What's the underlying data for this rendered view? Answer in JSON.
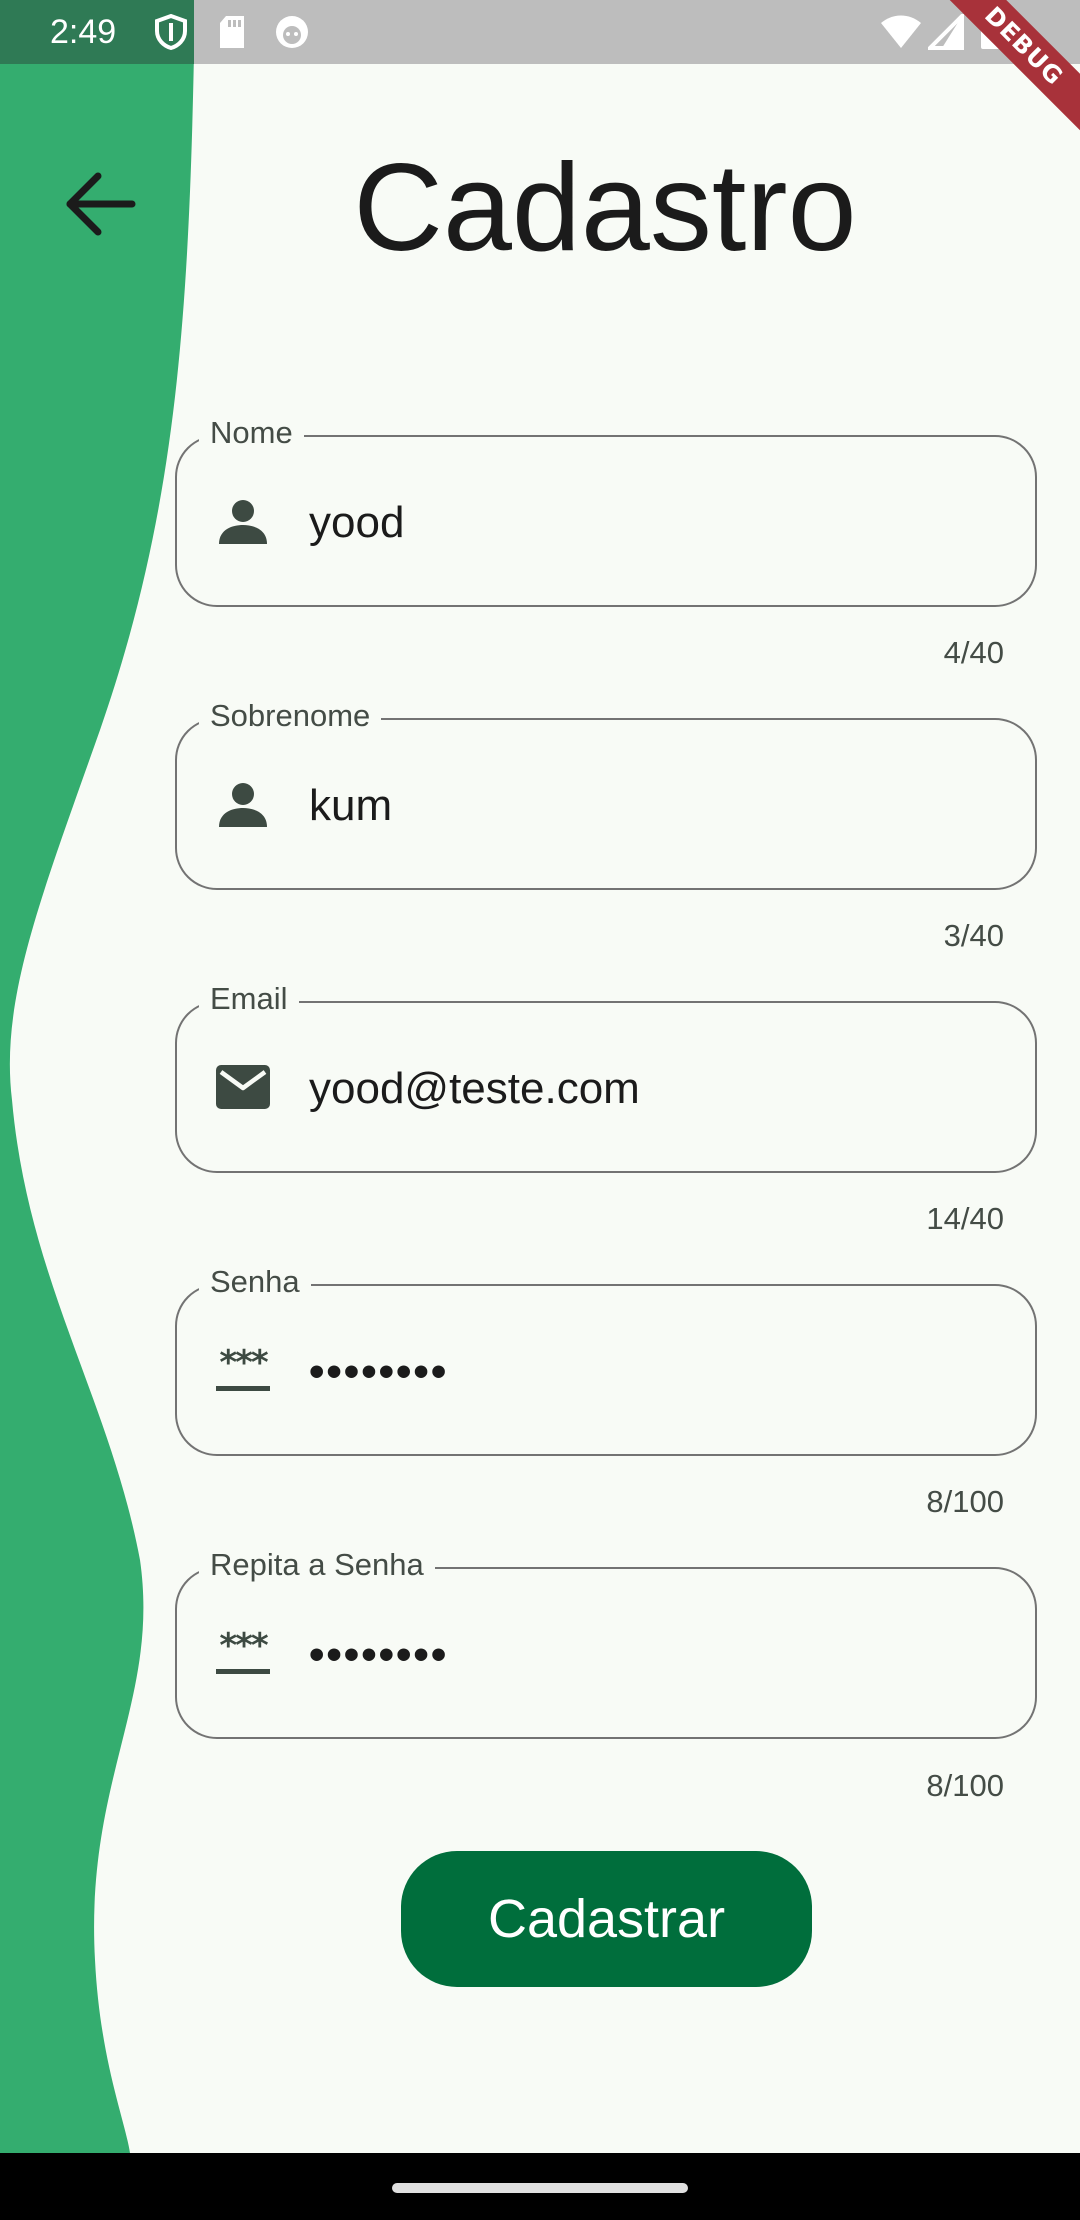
{
  "status_bar": {
    "time": "2:49",
    "icons": [
      "shield-icon",
      "sd-card-icon",
      "app-notification-icon",
      "wifi-icon",
      "signal-icon",
      "battery-icon"
    ],
    "debug_banner": "DEBUG"
  },
  "header": {
    "back_icon": "arrow-back-icon",
    "title": "Cadastro"
  },
  "form": {
    "first_name": {
      "label": "Nome",
      "value": "yood",
      "counter": "4/40",
      "icon": "person-icon"
    },
    "last_name": {
      "label": "Sobrenome",
      "value": "kum",
      "counter": "3/40",
      "icon": "person-icon"
    },
    "email": {
      "label": "Email",
      "value": "yood@teste.com",
      "counter": "14/40",
      "icon": "email-icon"
    },
    "password": {
      "label": "Senha",
      "value": "••••••••",
      "counter": "8/100",
      "icon": "password-icon"
    },
    "confirm_password": {
      "label": "Repita a Senha",
      "value": "••••••••",
      "counter": "8/100",
      "icon": "password-icon"
    },
    "submit_label": "Cadastrar"
  },
  "colors": {
    "accent": "#34ad6f",
    "primary_button": "#006e3c",
    "background": "#f8fbf6",
    "status_bar": "#bdbdbd",
    "debug_banner": "#a8323a"
  }
}
